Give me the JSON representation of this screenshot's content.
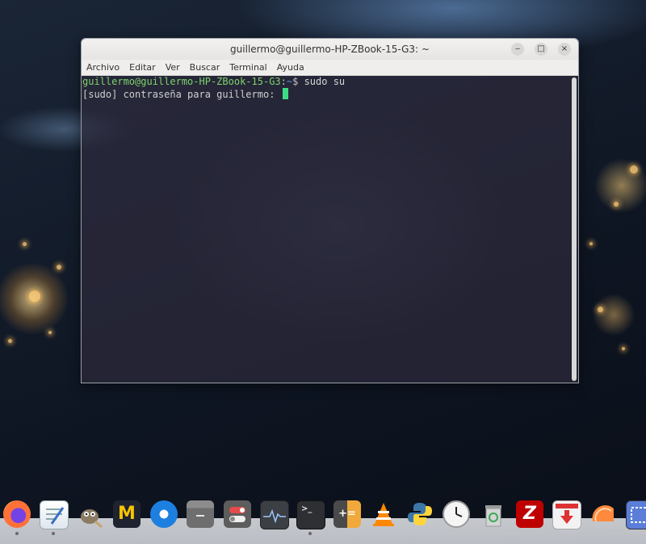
{
  "window": {
    "title": "guillermo@guillermo-HP-ZBook-15-G3: ~",
    "controls": {
      "minimize": "‒",
      "maximize": "□",
      "close": "×"
    }
  },
  "menubar": {
    "items": [
      "Archivo",
      "Editar",
      "Ver",
      "Buscar",
      "Terminal",
      "Ayuda"
    ]
  },
  "terminal": {
    "prompt_user": "guillermo@guillermo-HP-ZBook-15-G3",
    "prompt_sep": ":",
    "prompt_path": "~",
    "prompt_dollar": "$",
    "command": " sudo su",
    "line2": "[sudo] contraseña para guillermo: "
  },
  "colors": {
    "prompt_user": "#7fd36b",
    "prompt_path": "#6a93d6",
    "cursor": "#3ddc84",
    "terminal_bg": "#2c2a3c"
  },
  "dock": {
    "icons": [
      "firefox-icon",
      "text-editor-icon",
      "gimp-icon",
      "mendeley-icon",
      "thunderbird-icon",
      "files-icon",
      "settings-icon",
      "system-monitor-icon",
      "terminal-icon",
      "calculator-icon",
      "vlc-icon",
      "python-icon",
      "clock-icon",
      "trash-icon",
      "filezilla-icon",
      "downloader-icon",
      "orange-icon",
      "screenshot-icon"
    ],
    "glyphs": {
      "mendeley": "M",
      "terminal": ">_",
      "filezilla": "Z",
      "calculator": "+="
    }
  }
}
